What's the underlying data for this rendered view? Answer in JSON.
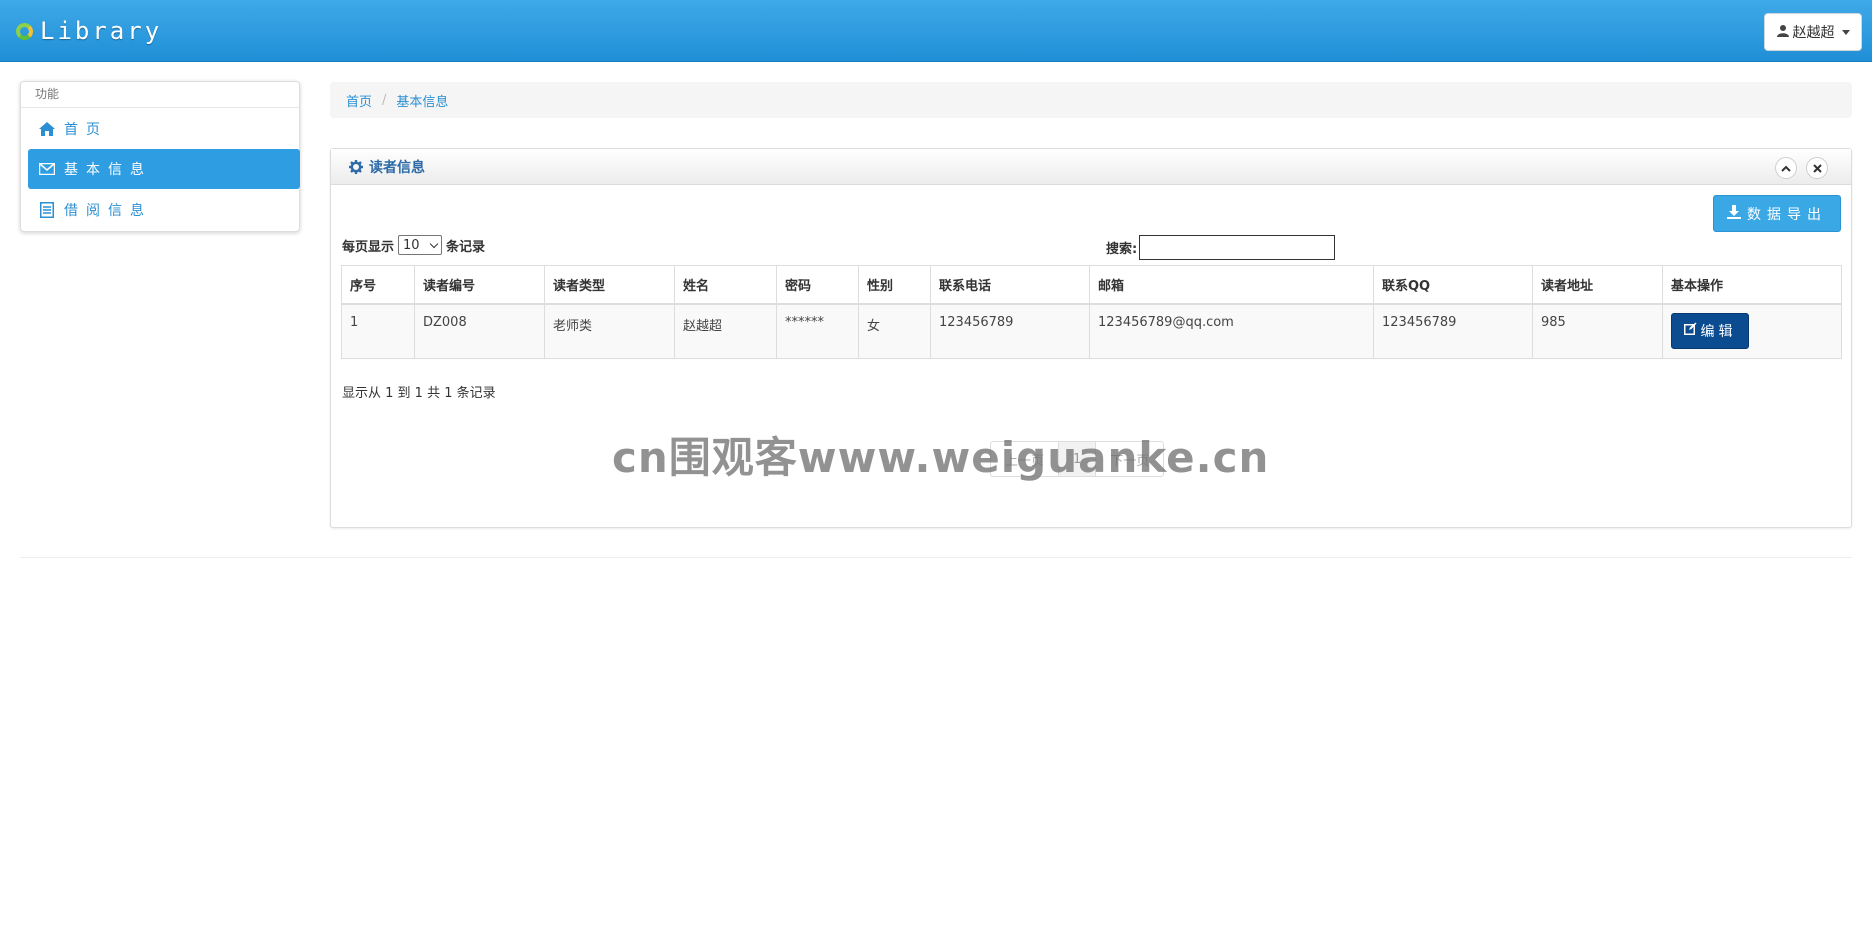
{
  "navbar": {
    "brand": "Library",
    "user_name": "赵越超",
    "accent_color": "#2f9de2"
  },
  "sidebar": {
    "header": "功能",
    "items": [
      {
        "label": "首页",
        "icon": "home-icon",
        "active": false
      },
      {
        "label": "基本信息",
        "icon": "envelope-icon",
        "active": true
      },
      {
        "label": "借阅信息",
        "icon": "list-icon",
        "active": false
      }
    ]
  },
  "breadcrumb": {
    "items": [
      "首页",
      "基本信息"
    ],
    "separator": "/"
  },
  "panel": {
    "title": "读者信息",
    "export_label": "数据导出",
    "length_prefix": "每页显示",
    "length_value": "10",
    "length_suffix": "条记录",
    "search_label": "搜索:",
    "search_value": "",
    "columns": [
      "序号",
      "读者编号",
      "读者类型",
      "姓名",
      "密码",
      "性别",
      "联系电话",
      "邮箱",
      "联系QQ",
      "读者地址",
      "基本操作"
    ],
    "rows": [
      {
        "cells": [
          "1",
          "DZ008",
          "老师类",
          "赵越超",
          "******",
          "女",
          "123456789",
          "123456789@qq.com",
          "123456789",
          "985"
        ],
        "action_label": "编辑"
      }
    ],
    "info": "显示从 1 到 1 共 1 条记录",
    "pager": {
      "prev": "上一页",
      "current": "1",
      "next": "下一页"
    }
  },
  "watermark": "cn围观客www.weiguanke.cn"
}
